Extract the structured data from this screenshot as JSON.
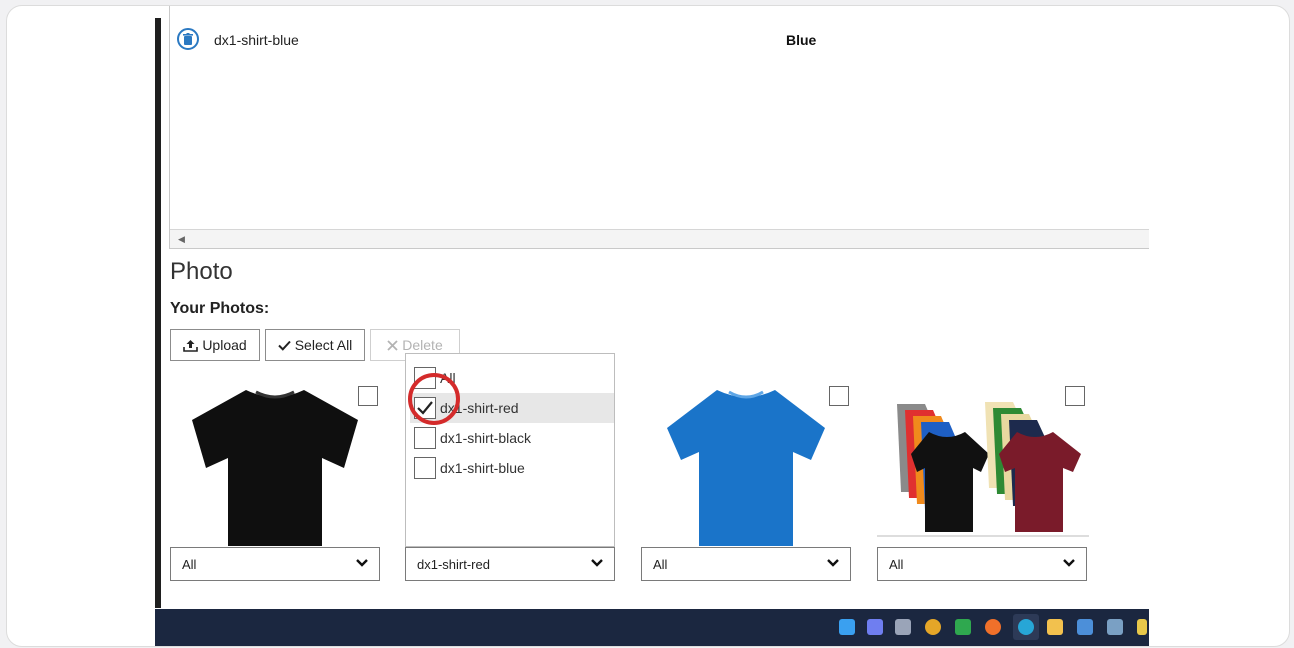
{
  "grid": {
    "row": {
      "name": "dx1-shirt-blue",
      "color": "Blue"
    }
  },
  "photo_section": {
    "title": "Photo",
    "subtitle": "Your Photos:"
  },
  "toolbar": {
    "upload_label": "Upload",
    "select_all_label": "Select All",
    "delete_label": "Delete"
  },
  "cards": [
    {
      "image": "black t-shirt",
      "select_value": "All"
    },
    {
      "image": "",
      "select_value": "dx1-shirt-red"
    },
    {
      "image": "blue t-shirt",
      "select_value": "All"
    },
    {
      "image": "multicolor t-shirts",
      "select_value": "All"
    }
  ],
  "dropdown": {
    "options": [
      {
        "label": "All",
        "checked": false
      },
      {
        "label": "dx1-shirt-red",
        "checked": true
      },
      {
        "label": "dx1-shirt-black",
        "checked": false
      },
      {
        "label": "dx1-shirt-blue",
        "checked": false
      }
    ]
  },
  "colors": {
    "accent": "#2b79c2",
    "highlight_circle": "#d42b2b",
    "taskbar": "#1b2740"
  }
}
